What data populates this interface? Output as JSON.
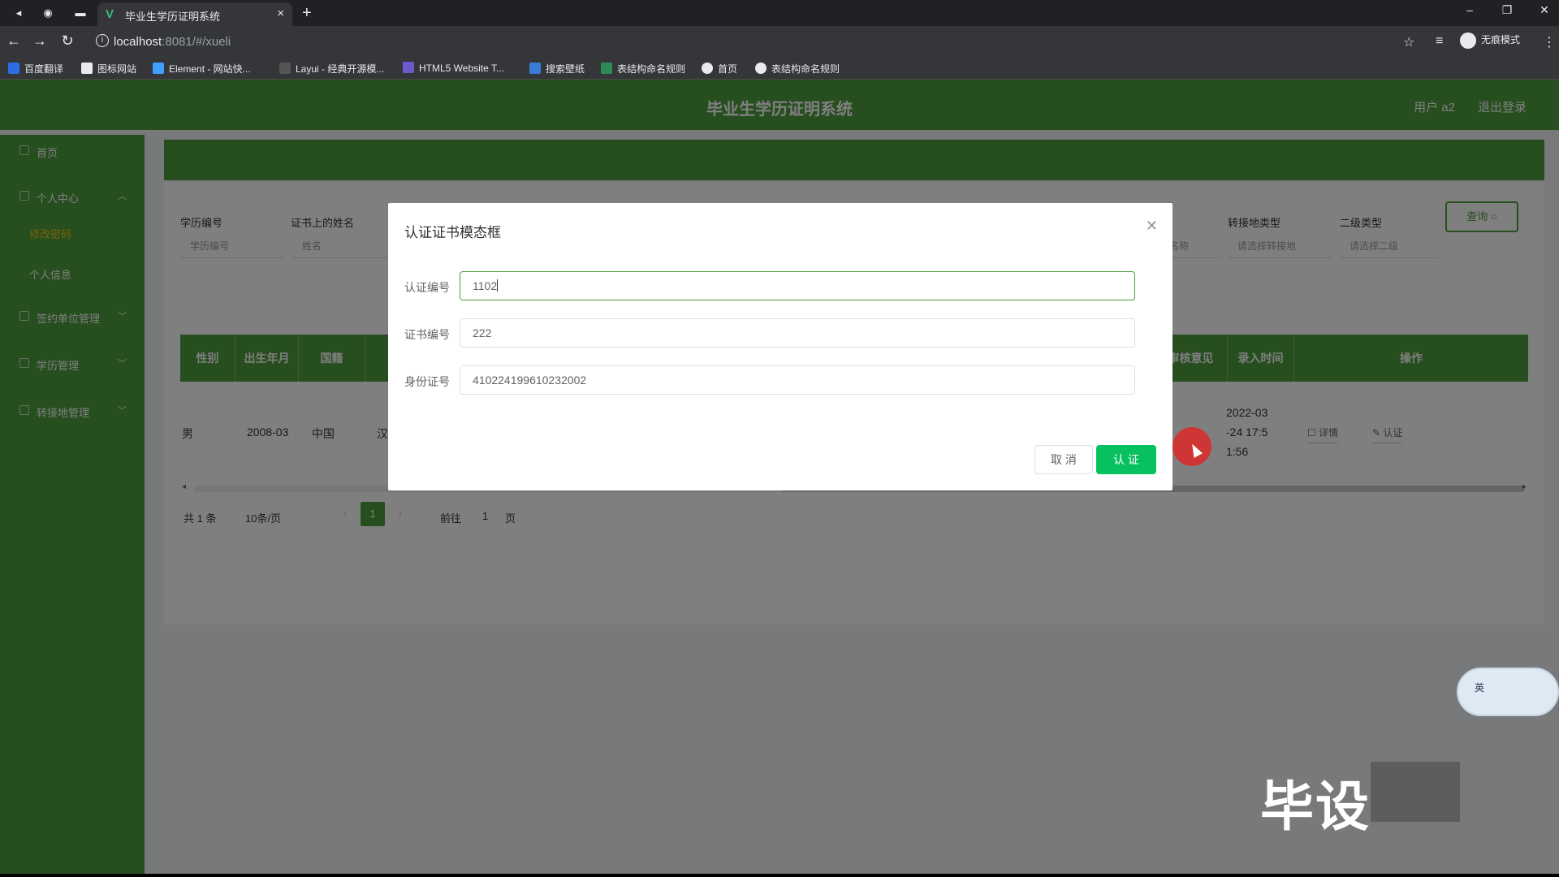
{
  "browser": {
    "tab_title": "毕业生学历证明系统",
    "url_host": "localhost",
    "url_path": ":8081/#/xueli",
    "incognito_label": "无痕模式",
    "bookmarks": [
      "百度翻译",
      "图标网站",
      "Element - 网站快...",
      "Layui - 经典开源模...",
      "HTML5 Website T...",
      "搜索壁纸",
      "表结构命名规则",
      "首页",
      "表结构命名规则"
    ]
  },
  "app": {
    "title": "毕业生学历证明系统",
    "user": "用户 a2",
    "logout": "退出登录"
  },
  "sidebar": {
    "items": [
      {
        "label": "首页"
      },
      {
        "label": "个人中心"
      },
      {
        "label": "修改密码"
      },
      {
        "label": "个人信息"
      },
      {
        "label": "签约单位管理"
      },
      {
        "label": "学历管理"
      },
      {
        "label": "转接地管理"
      }
    ]
  },
  "filters": {
    "labels": [
      "学历编号",
      "证书上的姓名",
      "转接地类型",
      "二级类型"
    ],
    "placeholders": [
      "学历编号",
      "姓名",
      "名称",
      "请选择转接地",
      "请选择二级"
    ],
    "query_button": "查询"
  },
  "table": {
    "headers": [
      "性别",
      "出生年月",
      "国籍",
      "审核意见",
      "录入时间",
      "操作"
    ],
    "row": {
      "gender": "男",
      "birth": "2008-03",
      "nationality": "中国",
      "ethnic_partial": "汉",
      "time_line1": "2022-03",
      "time_line2": "-24 17:5",
      "time_line3": "1:56",
      "op_detail": "详情",
      "op_verify": "认证"
    }
  },
  "pagination": {
    "total": "共 1 条",
    "page_size": "10条/页",
    "current": "1",
    "goto_label": "前往",
    "goto_value": "1",
    "page_suffix": "页"
  },
  "modal": {
    "title": "认证证书模态框",
    "fields": [
      {
        "label": "认证编号",
        "value": "1102"
      },
      {
        "label": "证书编号",
        "value": "222"
      },
      {
        "label": "身份证号",
        "value": "410224199610232002"
      }
    ],
    "cancel": "取 消",
    "confirm": "认 证"
  },
  "ime": {
    "label": "英"
  },
  "watermark": "毕设",
  "colors": {
    "primary": "#4e9c3e",
    "confirm": "#07c160"
  }
}
